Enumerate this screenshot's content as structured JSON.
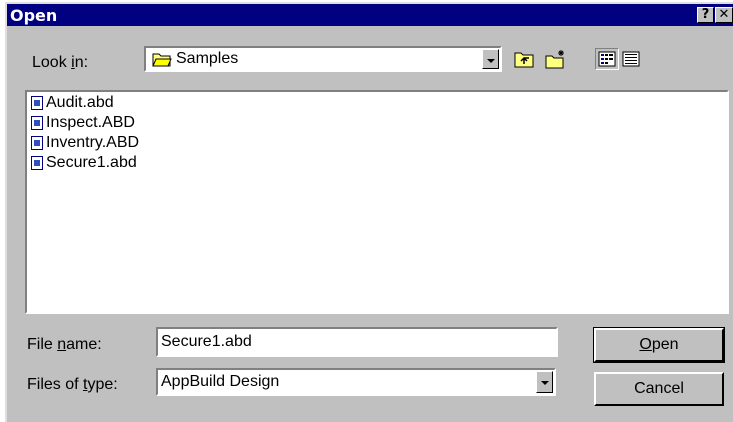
{
  "window": {
    "title": "Open",
    "help_button": "?",
    "close_button": "✕"
  },
  "look_in": {
    "label_pre": "Look ",
    "label_accel": "i",
    "label_post": "n:",
    "value": "Samples"
  },
  "toolbar": {
    "icons": [
      "up-one-level-icon",
      "create-new-folder-icon",
      "list-view-icon",
      "details-view-icon"
    ]
  },
  "files": [
    {
      "name": "Audit.abd"
    },
    {
      "name": "Inspect.ABD"
    },
    {
      "name": "Inventry.ABD"
    },
    {
      "name": "Secure1.abd"
    }
  ],
  "file_name": {
    "label_pre": "File ",
    "label_accel": "n",
    "label_post": "ame:",
    "value": "Secure1.abd"
  },
  "file_type": {
    "label_pre": "Files of ",
    "label_accel": "t",
    "label_post": "ype:",
    "value": "AppBuild Design"
  },
  "buttons": {
    "open_accel": "O",
    "open_rest": "pen",
    "cancel": "Cancel"
  },
  "colors": {
    "titlebar": "#000080",
    "face": "#c0c0c0"
  }
}
